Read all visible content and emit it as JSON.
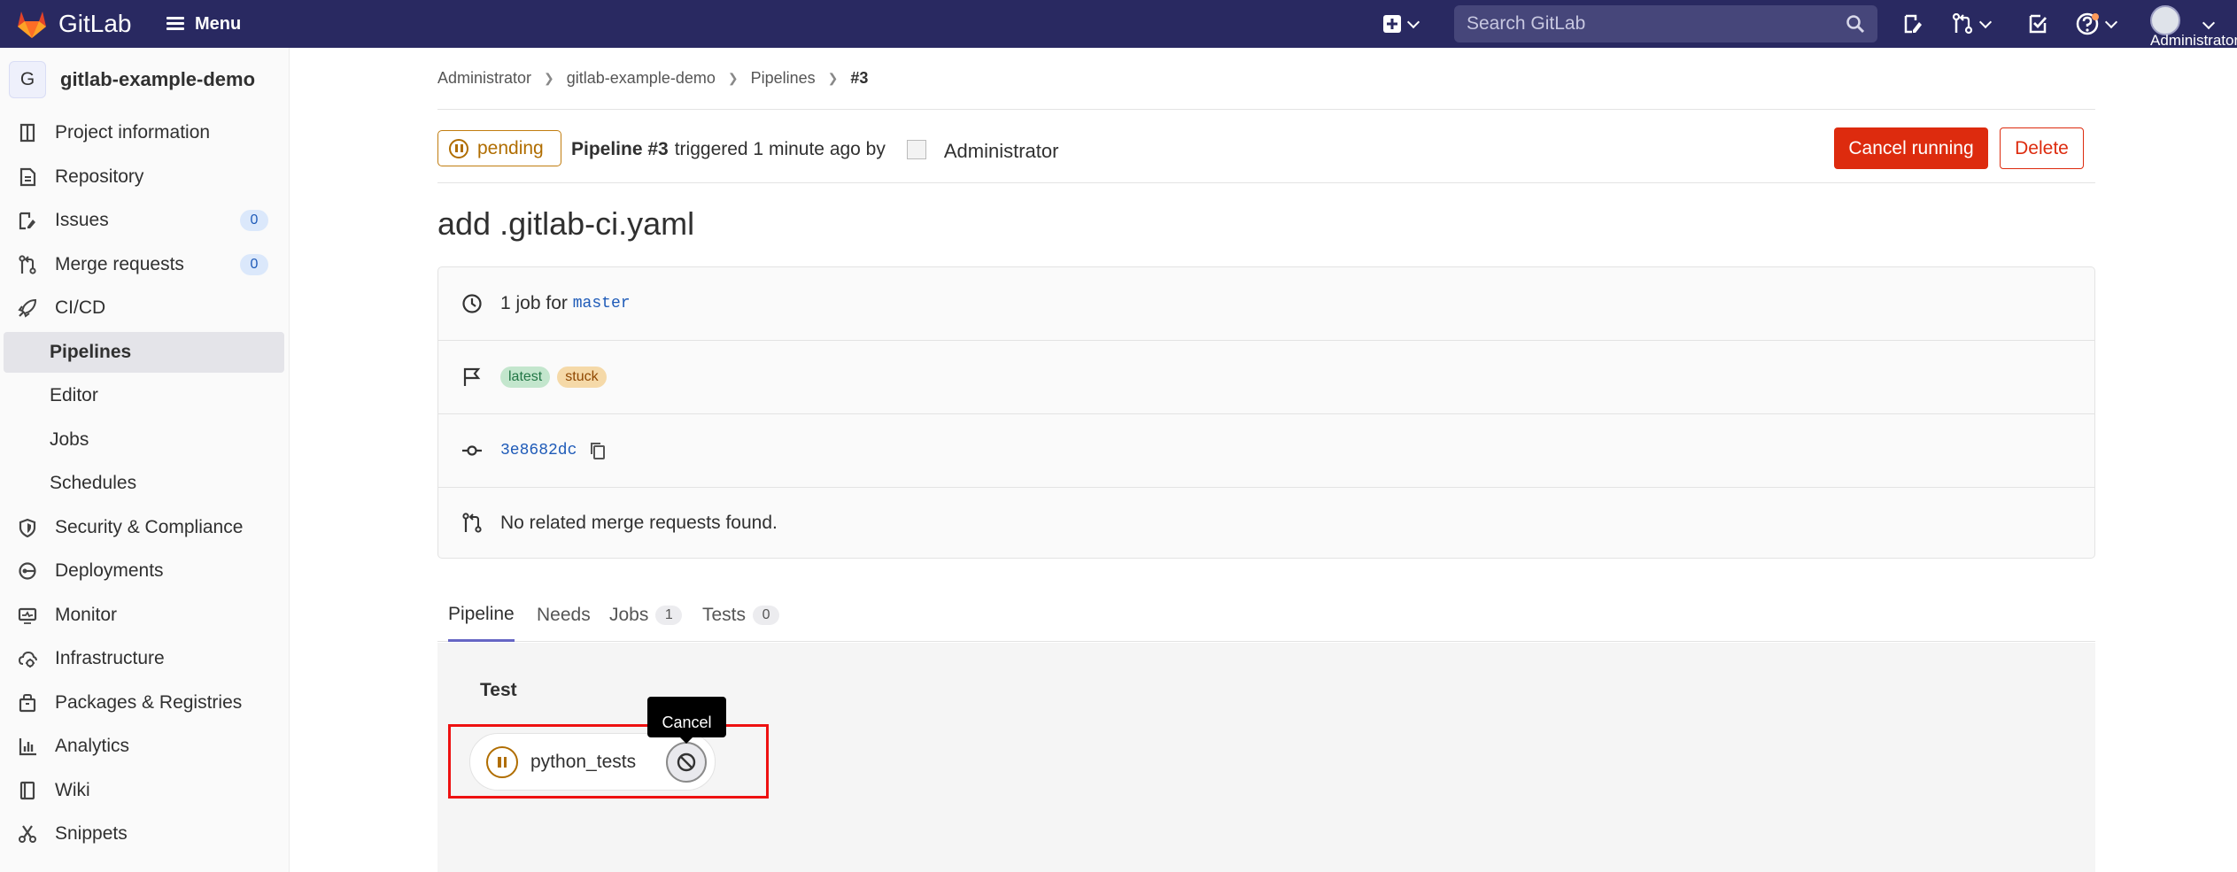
{
  "topbar": {
    "logo_text": "GitLab",
    "menu_label": "Menu",
    "search_placeholder": "Search GitLab",
    "user_name": "Administrator"
  },
  "sidebar": {
    "project_initial": "G",
    "project_name": "gitlab-example-demo",
    "items": [
      {
        "label": "Project information",
        "icon": "project-info-icon"
      },
      {
        "label": "Repository",
        "icon": "repository-icon"
      },
      {
        "label": "Issues",
        "icon": "issues-icon",
        "count": "0"
      },
      {
        "label": "Merge requests",
        "icon": "merge-request-icon",
        "count": "0"
      },
      {
        "label": "CI/CD",
        "icon": "rocket-icon"
      },
      {
        "label": "Pipelines",
        "active": true
      },
      {
        "label": "Editor"
      },
      {
        "label": "Jobs"
      },
      {
        "label": "Schedules"
      },
      {
        "label": "Security & Compliance",
        "icon": "shield-icon"
      },
      {
        "label": "Deployments",
        "icon": "deployments-icon"
      },
      {
        "label": "Monitor",
        "icon": "monitor-icon"
      },
      {
        "label": "Infrastructure",
        "icon": "cloud-gear-icon"
      },
      {
        "label": "Packages & Registries",
        "icon": "package-icon"
      },
      {
        "label": "Analytics",
        "icon": "chart-icon"
      },
      {
        "label": "Wiki",
        "icon": "book-icon"
      },
      {
        "label": "Snippets",
        "icon": "scissors-icon"
      }
    ]
  },
  "breadcrumb": [
    "Administrator",
    "gitlab-example-demo",
    "Pipelines",
    "#3"
  ],
  "pipeline": {
    "status": "pending",
    "name": "Pipeline #3",
    "triggered_text": "triggered 1 minute ago by",
    "user": "Administrator",
    "cancel_label": "Cancel running",
    "delete_label": "Delete",
    "title": "add .gitlab-ci.yaml",
    "job_count_text": "1 job for",
    "branch": "master",
    "tags": [
      "latest",
      "stuck"
    ],
    "commit_sha": "3e8682dc",
    "merge_request_text": "No related merge requests found."
  },
  "tabs": [
    {
      "label": "Pipeline",
      "active": true
    },
    {
      "label": "Needs"
    },
    {
      "label": "Jobs",
      "count": "1"
    },
    {
      "label": "Tests",
      "count": "0"
    }
  ],
  "graph": {
    "stage": "Test",
    "job_name": "python_tests",
    "tooltip": "Cancel"
  },
  "colors": {
    "topbar": "#292961",
    "danger": "#dd2b0e",
    "pending": "#b06d00",
    "highlight": "#ee1111",
    "active_tab": "#6666c4"
  }
}
